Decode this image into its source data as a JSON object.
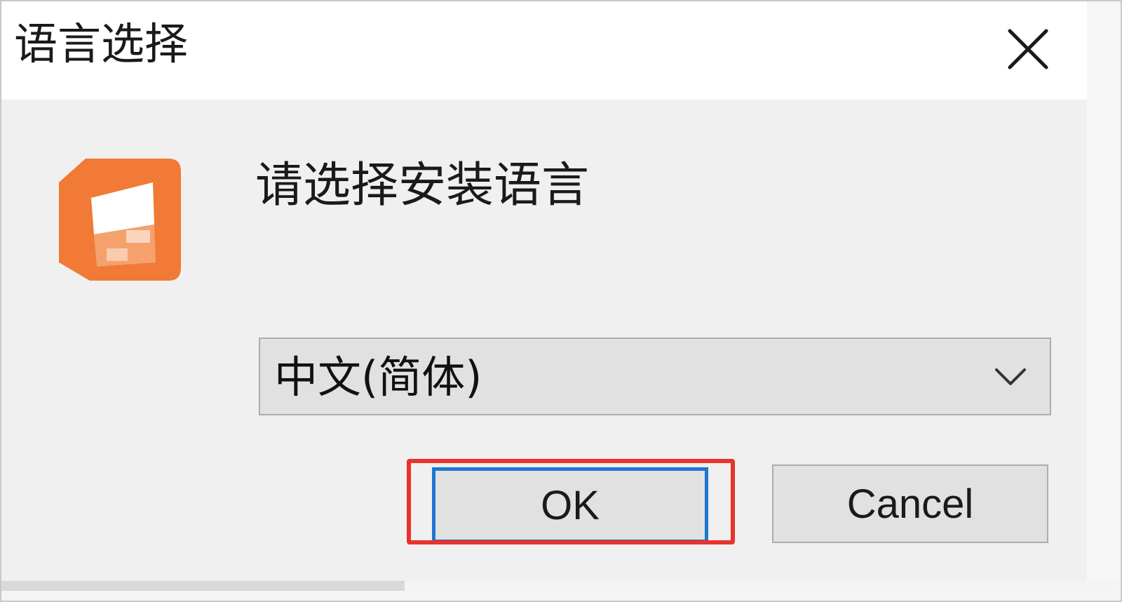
{
  "window": {
    "title": "语言选择",
    "close_icon": "close-icon"
  },
  "dialog": {
    "logo_icon": "app-logo-icon",
    "prompt": "请选择安装语言",
    "language_select": {
      "selected": "中文(简体)",
      "icon": "chevron-down-icon"
    },
    "ok_label": "OK",
    "cancel_label": "Cancel"
  },
  "colors": {
    "accent_logo": "#f07a36",
    "focus_border": "#1c77d3",
    "highlight_box": "#e8322c",
    "button_face": "#e1e1e1",
    "dialog_bg": "#f0f0f0"
  }
}
